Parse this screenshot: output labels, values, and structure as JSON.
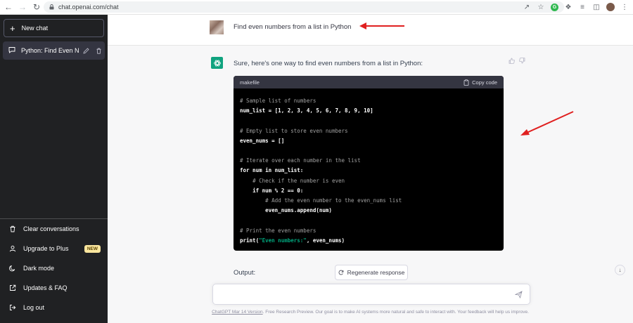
{
  "browser": {
    "url": "chat.openai.com/chat"
  },
  "sidebar": {
    "new_chat_label": "New chat",
    "chats": [
      {
        "title": "Python: Find Even Num"
      }
    ],
    "bottom_items": [
      {
        "label": "Clear conversations",
        "icon": "trash-icon"
      },
      {
        "label": "Upgrade to Plus",
        "icon": "user-icon",
        "badge": "NEW"
      },
      {
        "label": "Dark mode",
        "icon": "moon-icon"
      },
      {
        "label": "Updates & FAQ",
        "icon": "external-link-icon"
      },
      {
        "label": "Log out",
        "icon": "logout-icon"
      }
    ]
  },
  "conversation": {
    "user_message": "Find even numbers from a list in Python",
    "assistant_intro": "Sure, here's one way to find even numbers from a list in Python:",
    "code_language": "makefile",
    "copy_label": "Copy code",
    "output_label": "Output:"
  },
  "controls": {
    "regenerate_label": "Regenerate response",
    "input_placeholder": ""
  },
  "footer": {
    "version_link": "ChatGPT Mar 14 Version",
    "text": ". Free Research Preview. Our goal is to make AI systems more natural and safe to interact with. Your feedback will help us improve."
  },
  "colors": {
    "sidebar_bg": "#202123",
    "accent_green": "#10a37f",
    "annotation_arrow": "#e02020"
  }
}
